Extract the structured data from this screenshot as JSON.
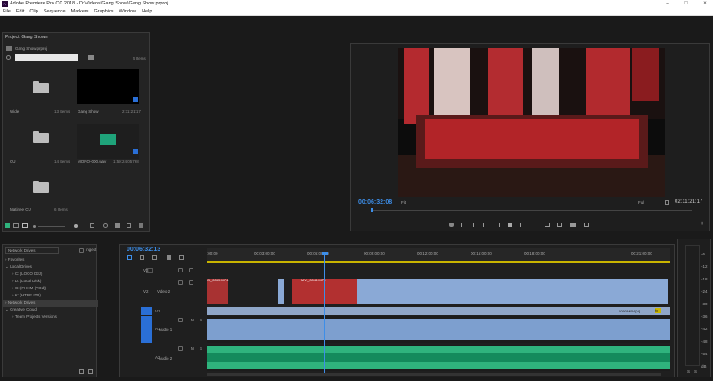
{
  "window": {
    "title": "Adobe Premiere Pro CC 2018 - D:\\Videos\\Gang Show\\Gang Show.prproj",
    "logo": "Pr",
    "minimize": "–",
    "maximize": "□",
    "close": "×"
  },
  "menu": [
    "File",
    "Edit",
    "Clip",
    "Sequence",
    "Markers",
    "Graphics",
    "Window",
    "Help"
  ],
  "project": {
    "tab": "Project: Gang Show",
    "tab_menu": "≡",
    "file": "Gang Show.prproj",
    "search_placeholder": "",
    "item_count": "5 Items",
    "items": [
      {
        "name": "Wide",
        "meta": "13 Items",
        "kind": "folder"
      },
      {
        "name": "Gang Show",
        "meta": "2:11:21:17",
        "kind": "sequence"
      },
      {
        "name": "CU",
        "meta": "14 Items",
        "kind": "folder"
      },
      {
        "name": "MONO-000.wav",
        "meta": "1:59:24:05798",
        "kind": "audio"
      },
      {
        "name": "Matinee CU",
        "meta": "6 Items",
        "kind": "folder"
      }
    ]
  },
  "program": {
    "timecode": "00:06:32:08",
    "fit": "Fit",
    "quality": "Full",
    "duration": "02:11:21:17"
  },
  "media_browser": {
    "location": "Network Drives",
    "ingest_label": "Ingest",
    "tree": [
      {
        "label": "Favorites",
        "level": 0,
        "arrow": "›"
      },
      {
        "label": "Local Drives",
        "level": 0,
        "arrow": "⌄"
      },
      {
        "label": "C: (LOCO DJJ)",
        "level": 1,
        "arrow": "›"
      },
      {
        "label": "D: (Local Disk)",
        "level": 1,
        "arrow": "›"
      },
      {
        "label": "G: (FHHM (VOd))",
        "level": 1,
        "arrow": "›"
      },
      {
        "label": "K: (HTRE ITB)",
        "level": 1,
        "arrow": "›"
      },
      {
        "label": "Network Drives",
        "level": 0,
        "arrow": "›",
        "selected": true
      },
      {
        "label": "Creative Cloud",
        "level": 0,
        "arrow": "⌄"
      },
      {
        "label": "Team Projects Versions",
        "level": 1,
        "arrow": "›"
      }
    ]
  },
  "timeline": {
    "timecode": "00:06:32:13",
    "ruler": [
      ":00:00",
      "00:03:00:00",
      "00:06:00:00",
      "00:09:00:00",
      "00:12:00:00",
      "00:15:00:00",
      "00:18:00:00",
      "00:21:00:00"
    ],
    "tracks": [
      {
        "id": "V3",
        "name": ""
      },
      {
        "id": "V2",
        "name": "Video 2"
      },
      {
        "id": "V1",
        "name": ""
      },
      {
        "id": "A1",
        "name": "Audio 1"
      },
      {
        "id": "A2",
        "name": "Audio 2"
      }
    ],
    "clips": {
      "v2_a": "CI_0039.MP4",
      "v2_b": "MVI_0048.MP4",
      "v1": "0050.MP4 [V]",
      "fx": "fx",
      "a2": "MONO-000.wav"
    },
    "track_letters": {
      "mute": "M",
      "solo": "S"
    }
  },
  "meter": {
    "scale": [
      "-6",
      "-12",
      "-18",
      "-24",
      "-30",
      "-36",
      "-42",
      "-48",
      "-54",
      "dB"
    ],
    "labels": [
      "S",
      "S"
    ]
  }
}
